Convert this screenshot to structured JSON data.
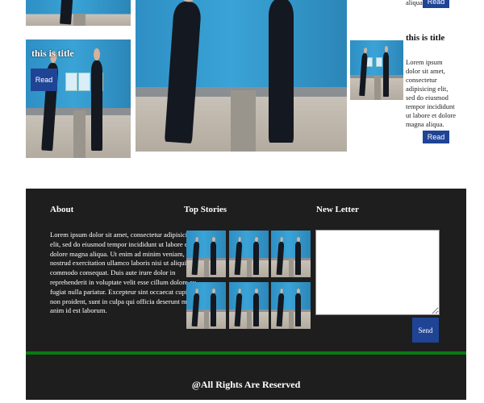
{
  "cards": {
    "card_title": "this is title",
    "read_label": "Read",
    "side_title": "this is title",
    "side_text": "Lorem ipsum dolor sit amet, consectetur adipisicing elit, sed do eiusmod tempor incididunt ut labore et dolore magna aliqua.",
    "top_fragment": "aliqua."
  },
  "footer": {
    "about_heading": "About",
    "about_text": "Lorem ipsum dolor sit amet, consectetur adipisicing elit, sed do eiusmod tempor incididunt ut labore et dolore magna aliqua. Ut enim ad minim veniam, quis nostrud exercitation ullamco laboris nisi ut aliquip ex ea commodo consequat. Duis aute irure dolor in reprehenderit in voluptate velit esse cillum dolore eu fugiat nulla pariatur. Excepteur sint occaecat cupidatat non proident, sunt in culpa qui officia deserunt mollit anim id est laborum.",
    "top_stories_heading": "Top Stories",
    "newsletter_heading": "New Letter",
    "send_label": "Send",
    "copyright": "@All Rights Are Reserved"
  },
  "colors": {
    "button_blue": "#1f4496",
    "footer_bg": "#1e1e1e",
    "accent_green": "#0a7a12"
  }
}
